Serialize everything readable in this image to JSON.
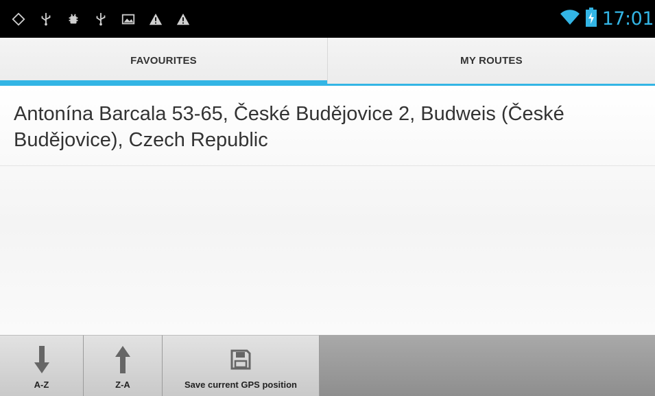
{
  "statusbar": {
    "left_icons": [
      "location-icon",
      "usb-icon",
      "android-debug-icon",
      "usb-icon",
      "image-icon",
      "warning-icon",
      "warning-icon"
    ],
    "clock": "17:01",
    "accent_color": "#33b5e5"
  },
  "tabs": [
    {
      "label": "FAVOURITES",
      "active": true
    },
    {
      "label": "MY ROUTES",
      "active": false
    }
  ],
  "favourites": [
    {
      "address": "Antonína Barcala 53-65, České Budějovice 2, Budweis (České Budějovice), Czech Republic"
    }
  ],
  "bottombar": {
    "sort_az_label": "A-Z",
    "sort_za_label": "Z-A",
    "save_gps_label": "Save current GPS position"
  }
}
